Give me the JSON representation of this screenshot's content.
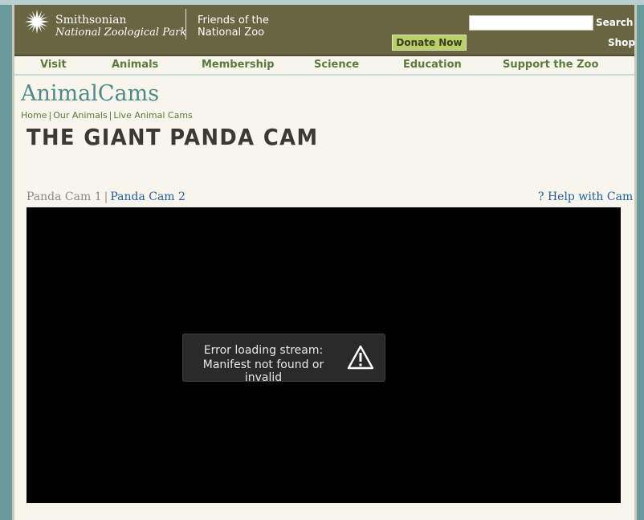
{
  "header": {
    "logo_line1": "Smithsonian",
    "logo_line2": "National Zoological Park",
    "friends_line1": "Friends of the",
    "friends_line2": "National Zoo",
    "search_label": "Search",
    "search_value": "",
    "donate_label": "Donate Now",
    "shop_label": "Shop"
  },
  "nav": {
    "items": [
      "Visit",
      "Animals",
      "Membership",
      "Science",
      "Education",
      "Support the Zoo"
    ]
  },
  "content": {
    "site_title": "AnimalCams",
    "breadcrumb": [
      "Home",
      "Our Animals",
      "Live Animal Cams"
    ],
    "page_title": "THE GIANT PANDA CAM",
    "cam_tabs": [
      "Panda Cam 1",
      "Panda Cam 2"
    ],
    "help_link": "? Help with Cam"
  },
  "player": {
    "error_line1": "Error loading stream:",
    "error_line2": "Manifest not found or invalid",
    "error_icon": "warning-triangle-icon"
  },
  "colors": {
    "header_bg": "#696542",
    "nav_link": "#5a7a3c",
    "title_teal": "#4f8a8a",
    "link_blue": "#1f5fa0",
    "donate_bg": "#b9cf6a"
  }
}
